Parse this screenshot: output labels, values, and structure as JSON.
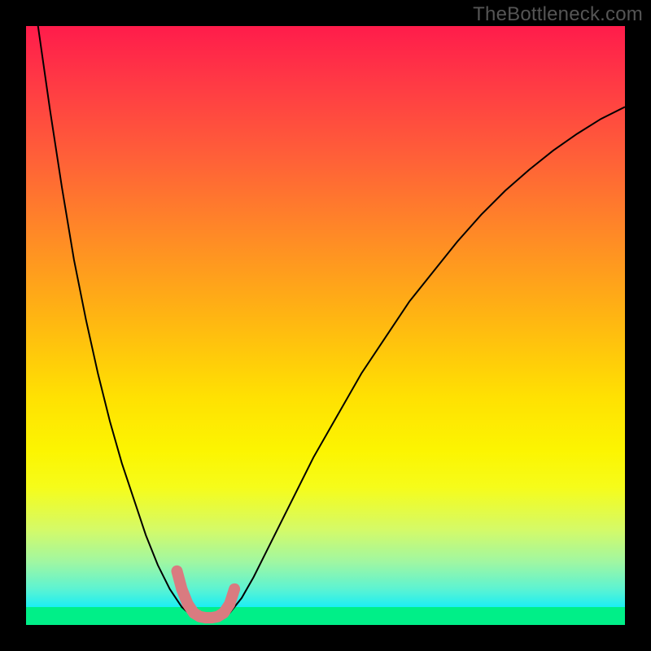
{
  "watermark": "TheBottleneck.com",
  "colors": {
    "frame": "#000000",
    "curve": "#000000",
    "overlay": "#d97b80",
    "gradient_stops": [
      "#ff1c4b",
      "#ff3845",
      "#ff6038",
      "#ff8a26",
      "#ffb313",
      "#ffe102",
      "#fcf501",
      "#f6fc1a",
      "#d5fa67",
      "#a0f7a2",
      "#5cf3d2",
      "#1ceef3",
      "#00ec8a"
    ]
  },
  "chart_data": {
    "type": "line",
    "title": "",
    "xlabel": "",
    "ylabel": "",
    "xlim": [
      0,
      100
    ],
    "ylim": [
      0,
      100
    ],
    "series": [
      {
        "name": "bottleneck-curve",
        "x": [
          0,
          2,
          4,
          6,
          8,
          10,
          12,
          14,
          16,
          18,
          20,
          22,
          24,
          26,
          28,
          29,
          30,
          32,
          34,
          36,
          38,
          40,
          44,
          48,
          52,
          56,
          60,
          64,
          68,
          72,
          76,
          80,
          84,
          88,
          92,
          96,
          100
        ],
        "values": [
          115,
          100,
          86,
          73,
          61,
          51,
          42,
          34,
          27,
          21,
          15,
          10,
          6,
          3,
          1.2,
          1,
          1,
          1,
          2,
          4.5,
          8,
          12,
          20,
          28,
          35,
          42,
          48,
          54,
          59,
          64,
          68.5,
          72.5,
          76,
          79.2,
          82,
          84.5,
          86.5
        ]
      }
    ],
    "annotations": [
      {
        "name": "pink-overlay",
        "description": "highlight along valley floor",
        "x": [
          25.2,
          26.0,
          27.0,
          28.0,
          29.0,
          30.0,
          31.0,
          32.0,
          33.0,
          34.0,
          34.8
        ],
        "values": [
          9.0,
          6.0,
          3.5,
          2.0,
          1.4,
          1.2,
          1.2,
          1.4,
          2.0,
          3.5,
          6.0
        ]
      }
    ]
  }
}
